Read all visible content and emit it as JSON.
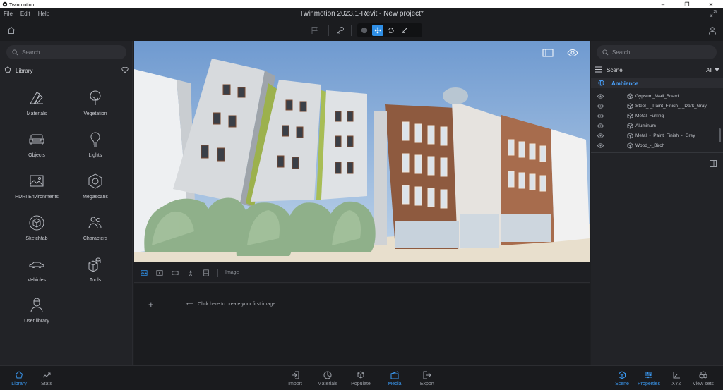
{
  "window": {
    "app_name": "Twinmotion",
    "title": "Twinmotion 2023.1-Revit - New project*"
  },
  "menu": [
    "File",
    "Edit",
    "Help"
  ],
  "left_panel": {
    "search_placeholder": "Search",
    "section_title": "Library",
    "categories": [
      {
        "label": "Materials",
        "icon": "materials-icon"
      },
      {
        "label": "Vegetation",
        "icon": "tree-icon"
      },
      {
        "label": "Objects",
        "icon": "sofa-icon"
      },
      {
        "label": "Lights",
        "icon": "lightbulb-icon"
      },
      {
        "label": "HDRI Environments",
        "icon": "image-icon"
      },
      {
        "label": "Megascans",
        "icon": "megascans-icon"
      },
      {
        "label": "Sketchfab",
        "icon": "sketchfab-icon"
      },
      {
        "label": "Characters",
        "icon": "characters-icon"
      },
      {
        "label": "Vehicles",
        "icon": "car-icon"
      },
      {
        "label": "Tools",
        "icon": "tools-icon"
      },
      {
        "label": "User library",
        "icon": "user-icon"
      }
    ]
  },
  "media": {
    "tab_label": "Image",
    "hint": "Click here to create your first image"
  },
  "right_panel": {
    "search_placeholder": "Search",
    "scene_title": "Scene",
    "filter": "All",
    "selected_item": "Ambience",
    "materials": [
      "Gypsum_Wall_Board",
      "Steel_-_Paint_Finish_-_Dark_Gray",
      "Metal_Furring",
      "Aluminum",
      "Metal_-_Paint_Finish_-_Grey",
      "Wood_-_Birch"
    ]
  },
  "bottom_bar": {
    "left": [
      {
        "label": "Library",
        "active": true
      },
      {
        "label": "Stats",
        "active": false
      }
    ],
    "center": [
      {
        "label": "Import",
        "active": false
      },
      {
        "label": "Materials",
        "active": false
      },
      {
        "label": "Populate",
        "active": false
      },
      {
        "label": "Media",
        "active": true
      },
      {
        "label": "Export",
        "active": false
      }
    ],
    "right": [
      {
        "label": "Scene",
        "active": true
      },
      {
        "label": "Properties",
        "active": true
      },
      {
        "label": "XYZ",
        "active": false
      },
      {
        "label": "View sets",
        "active": false
      }
    ]
  },
  "colors": {
    "accent": "#2f8fe6",
    "panel": "#222327",
    "background": "#1b1c1f"
  }
}
